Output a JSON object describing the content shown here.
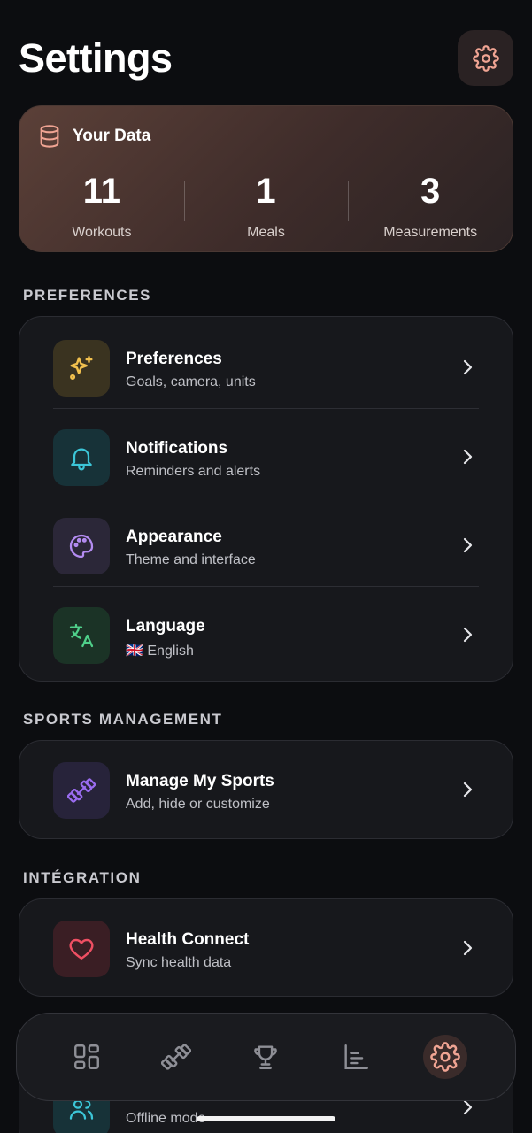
{
  "header": {
    "title": "Settings"
  },
  "your_data": {
    "title": "Your Data",
    "stats": [
      {
        "value": "11",
        "label": "Workouts"
      },
      {
        "value": "1",
        "label": "Meals"
      },
      {
        "value": "3",
        "label": "Measurements"
      }
    ]
  },
  "sections": {
    "preferences": {
      "title": "PREFERENCES",
      "items": [
        {
          "title": "Preferences",
          "subtitle": "Goals, camera, units",
          "icon": "sparkles-icon",
          "color": "#f2c14e"
        },
        {
          "title": "Notifications",
          "subtitle": "Reminders and alerts",
          "icon": "bell-icon",
          "color": "#3cc6d8"
        },
        {
          "title": "Appearance",
          "subtitle": "Theme and interface",
          "icon": "palette-icon",
          "color": "#b48cf2"
        },
        {
          "title": "Language",
          "subtitle": "🇬🇧 English",
          "icon": "translate-icon",
          "color": "#4fd08a"
        }
      ]
    },
    "sports": {
      "title": "SPORTS MANAGEMENT",
      "items": [
        {
          "title": "Manage My Sports",
          "subtitle": "Add, hide or customize",
          "icon": "dumbbell-icon",
          "color": "#9a6cf0"
        }
      ]
    },
    "integration": {
      "title": "INTÉGRATION",
      "items": [
        {
          "title": "Health Connect",
          "subtitle": "Sync health data",
          "icon": "heart-icon",
          "color": "#ef4f63"
        }
      ]
    }
  },
  "peek_row": {
    "subtitle": "Offline mode"
  },
  "nav": {
    "items": [
      "dashboard-icon",
      "dumbbell-icon",
      "trophy-icon",
      "chart-icon",
      "gear-icon"
    ],
    "active": "gear-icon"
  },
  "colors": {
    "accent": "#f0a493",
    "background": "#0c0d10",
    "card": "#17181c"
  }
}
